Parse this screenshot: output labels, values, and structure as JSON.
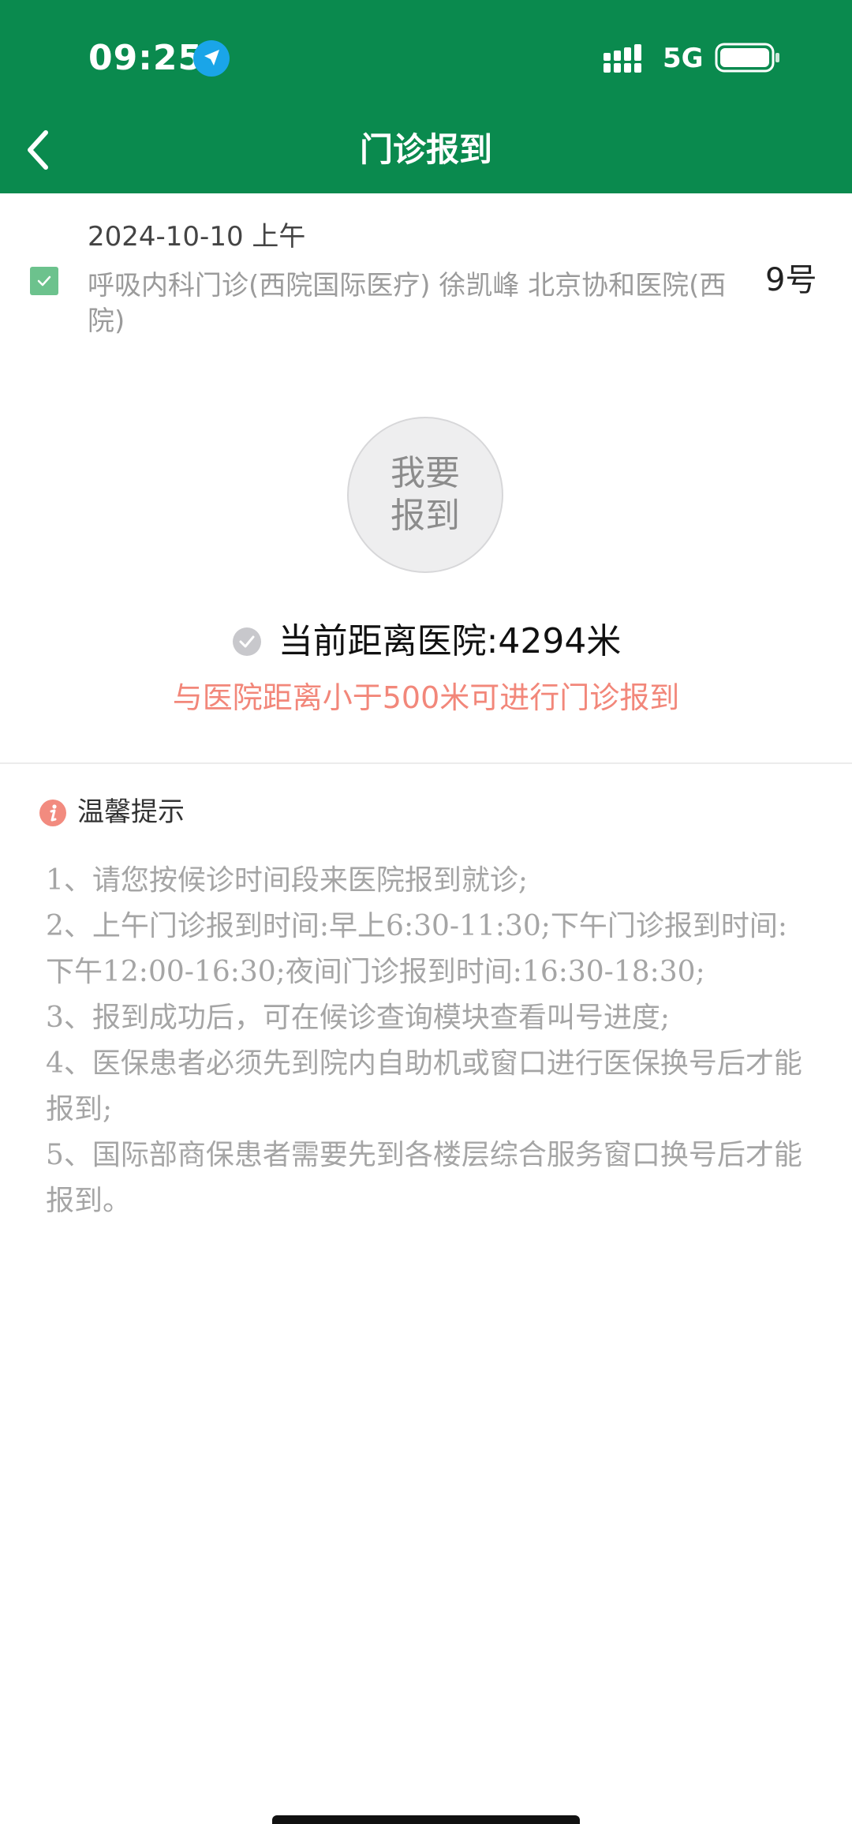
{
  "status_bar": {
    "time": "09:25",
    "network": "5G",
    "icons": [
      "location-arrow-icon",
      "signal-icon",
      "battery-icon"
    ]
  },
  "nav": {
    "title": "门诊报到",
    "back_icon": "chevron-left-icon"
  },
  "appointment": {
    "checked": true,
    "date": "2024-10-10 上午",
    "description": "呼吸内科门诊(西院国际医疗) 徐凯峰 北京协和医院(西院)",
    "number": "9号"
  },
  "checkin": {
    "button_label": "我要报到",
    "distance_text": "当前距离医院:4294米",
    "distance_note": "与医院距离小于500米可进行门诊报到"
  },
  "tips": {
    "title": "温馨提示",
    "items": [
      "1、请您按候诊时间段来医院报到就诊;",
      "2、上午门诊报到时间:早上6:30-11:30;下午门诊报到时间:下午12:00-16:30;夜间门诊报到时间:16:30-18:30;",
      "3、报到成功后，可在候诊查询模块查看叫号进度;",
      "4、医保患者必须先到院内自助机或窗口进行医保换号后才能报到;",
      "5、国际部商保患者需要先到各楼层综合服务窗口换号后才能报到。"
    ]
  },
  "colors": {
    "header": "#0a8a4e",
    "checkbox": "#6cc28d",
    "note": "#f2877a",
    "info_icon": "#f28b7f"
  }
}
